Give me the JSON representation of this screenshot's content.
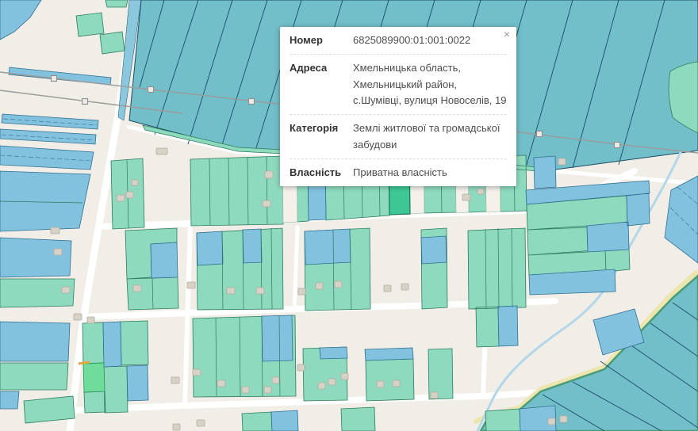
{
  "popup": {
    "close_label": "×",
    "rows": [
      {
        "label": "Номер",
        "value": "6825089900:01:001:0022"
      },
      {
        "label": "Адреса",
        "value": "Хмельницька область, Хмельницький район, с.Шумівці, вулиця Новоселів, 19"
      },
      {
        "label": "Категорія",
        "value": "Землі житлової та громадської забудови"
      },
      {
        "label": "Власність",
        "value": "Приватна власність"
      }
    ]
  },
  "palette": {
    "bg": "#f1eee7",
    "road": "#ffffff",
    "parcelGreen": "#8edabe",
    "parcelGreenStroke": "#2c7a5e",
    "parcelBlue": "#83c2de",
    "parcelBlueStroke": "#2f6e91",
    "paleParcel": "#f3f1ea",
    "parcelSelected": "#3ec795",
    "parcelSelectedStroke": "#177a55",
    "parcelHighlight": "#6fdc9c",
    "fieldTeal": "#72bec9",
    "fieldStroke": "#1a4d63",
    "bandBlue": "#8cc8dd",
    "water": "#b3d7e8",
    "pathYellow": "#ece6ae",
    "building": "#d7d2c8",
    "buildingStroke": "#b2ac9f",
    "powerline": "#9b9b9b",
    "popupBg": "#ffffff",
    "labelColor": "#333333",
    "valueColor": "#4d4d4d",
    "divider": "#dddddd",
    "closeColor": "#999999",
    "orangeTick": "#e8a33d"
  }
}
